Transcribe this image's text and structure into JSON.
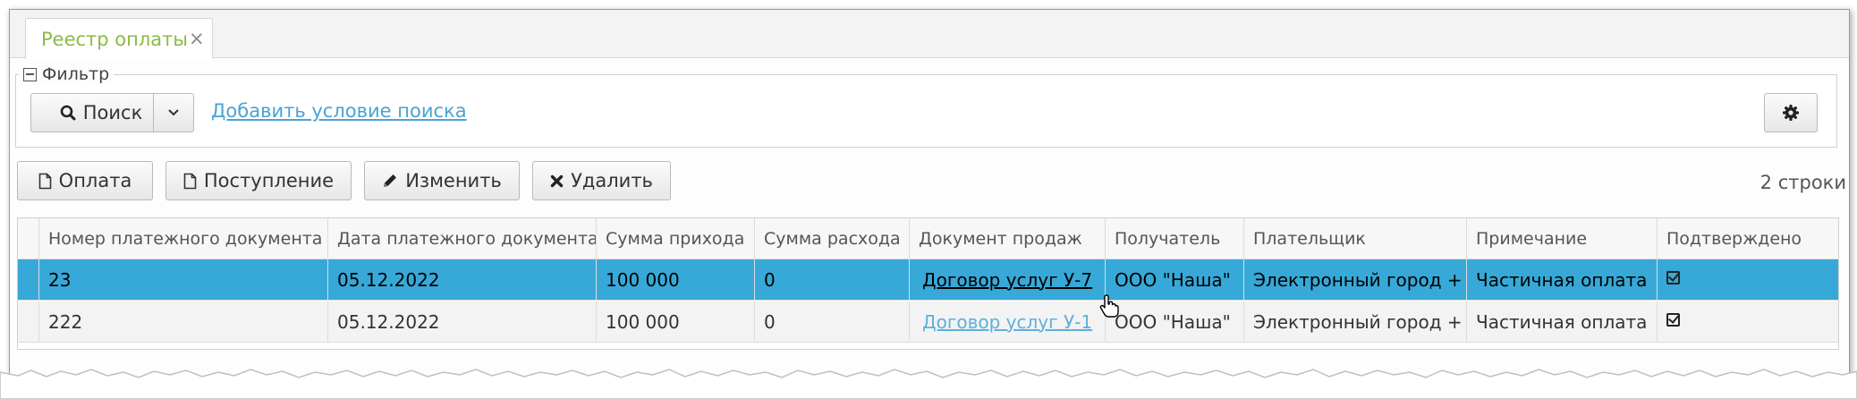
{
  "tab": {
    "title": "Реестр оплаты",
    "close": "×"
  },
  "filter": {
    "legend": "Фильтр",
    "search_label": "Поиск",
    "add_condition": "Добавить условие поиска"
  },
  "toolbar": {
    "payment": "Оплата",
    "receipt": "Поступление",
    "edit": "Изменить",
    "delete": "Удалить"
  },
  "row_count": "2 строки",
  "table": {
    "columns": [
      "Номер платежного документа",
      "Дата платежного документа",
      "Сумма прихода",
      "Сумма расхода",
      "Документ продаж",
      "Получатель",
      "Плательщик",
      "Примечание",
      "Подтверждено"
    ],
    "rows": [
      {
        "number": "23",
        "date": "05.12.2022",
        "income": "100 000",
        "expense": "0",
        "sales_doc": "Договор услуг У-7",
        "recipient": "ООО \"Наша\"",
        "payer": "Электронный город +",
        "note": "Частичная оплата",
        "confirmed": true,
        "selected": true
      },
      {
        "number": "222",
        "date": "05.12.2022",
        "income": "100 000",
        "expense": "0",
        "sales_doc": "Договор услуг У-1",
        "recipient": "ООО \"Наша\"",
        "payer": "Электронный город +",
        "note": "Частичная оплата",
        "confirmed": true,
        "selected": false
      }
    ]
  },
  "colors": {
    "accent_tab": "#8bbb46",
    "link": "#4aa3d4",
    "selected_row": "#37a9d8"
  },
  "icons": {
    "filter_toggle": "minus-square-icon",
    "search": "search-icon",
    "dropdown": "chevron-down-icon",
    "settings": "gear-icon",
    "payment": "file-icon",
    "receipt": "file-icon",
    "edit": "pencil-icon",
    "delete": "x-icon",
    "confirmed": "checked-checkbox-icon",
    "cursor": "hand-pointer-icon"
  }
}
